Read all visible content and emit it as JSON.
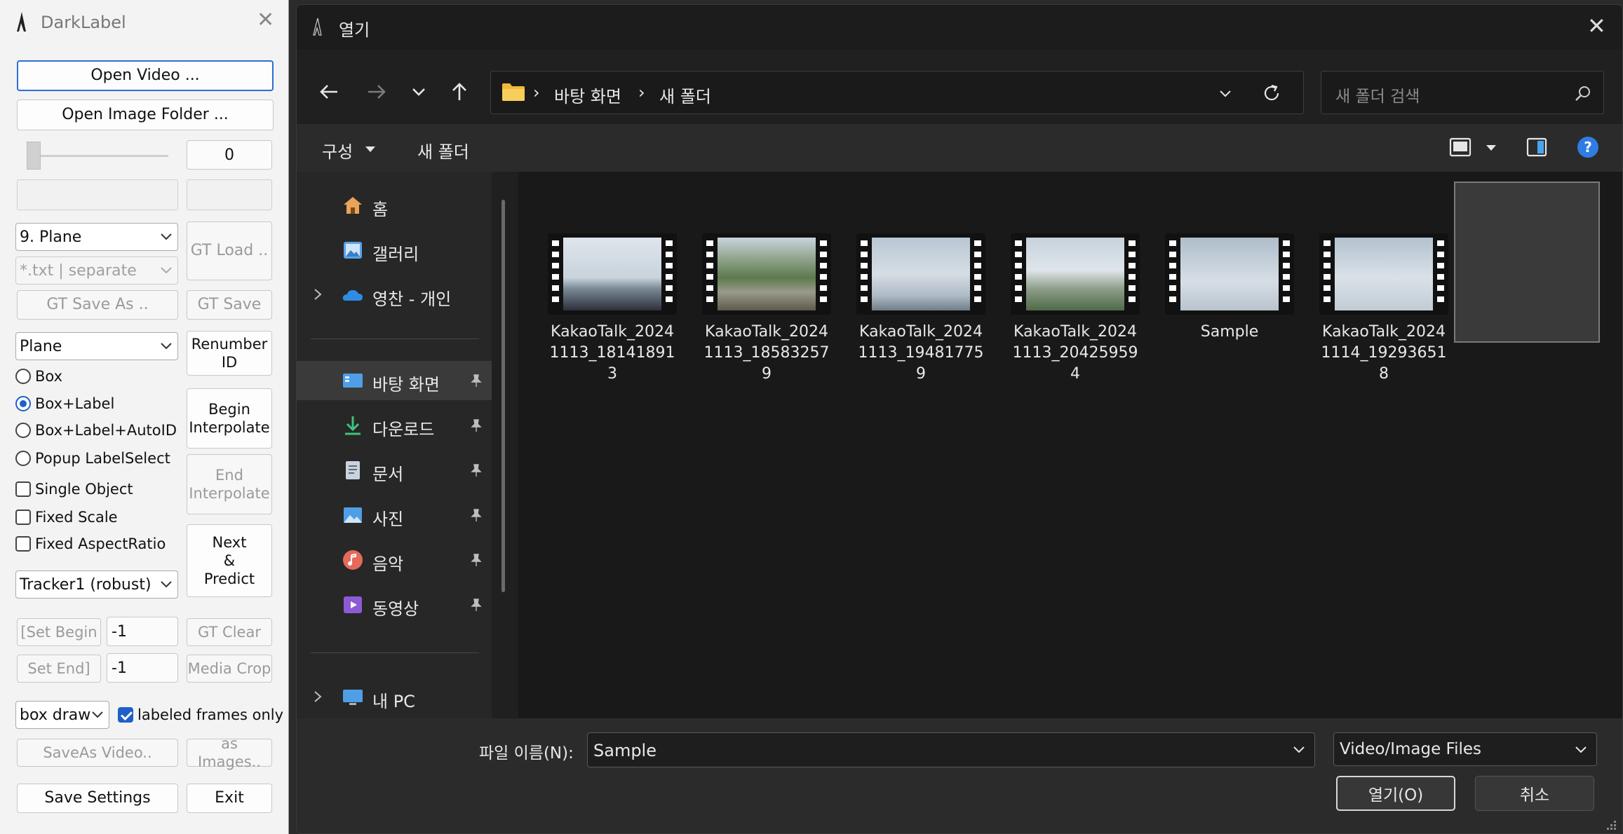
{
  "darklabel": {
    "title": "DarkLabel",
    "open_video": "Open Video ...",
    "open_image_folder": "Open Image Folder ...",
    "frame_number": "0",
    "class_select": "9. Plane",
    "format_select": "*.txt | separate",
    "gt_load": "GT Load ..",
    "gt_save_as": "GT Save As ..",
    "gt_save": "GT Save",
    "label_select": "Plane",
    "renumber_id": "Renumber ID",
    "radio_box": "Box",
    "radio_box_label": "Box+Label",
    "radio_box_label_autoid": "Box+Label+AutoID",
    "radio_popup": "Popup LabelSelect",
    "begin_interpolate": "Begin Interpolate",
    "end_interpolate": "End Interpolate",
    "single_object": "Single Object",
    "fixed_scale": "Fixed Scale",
    "fixed_aspect": "Fixed AspectRatio",
    "next_predict_1": "Next",
    "next_predict_2": "&",
    "next_predict_3": "Predict",
    "tracker_select": "Tracker1 (robust)",
    "set_begin": "[Set Begin",
    "set_begin_value": "-1",
    "gt_clear": "GT Clear",
    "set_end": "Set End]",
    "set_end_value": "-1",
    "media_crop": "Media Crop",
    "draw_select": "box draw",
    "labeled_frames_only": "labeled frames only",
    "save_as_video": "SaveAs Video..",
    "as_images": "as Images..",
    "save_settings": "Save Settings",
    "exit": "Exit"
  },
  "dialog": {
    "title": "열기",
    "path": [
      "바탕 화면",
      "새 폴더"
    ],
    "search_placeholder": "새 폴더 검색",
    "organize": "구성",
    "new_folder": "새 폴더",
    "nav": [
      {
        "label": "홈",
        "icon": "home-icon"
      },
      {
        "label": "갤러리",
        "icon": "gallery-icon"
      },
      {
        "label": "영찬 - 개인",
        "icon": "onedrive-icon"
      },
      {
        "label": "바탕 화면",
        "icon": "desktop-icon"
      },
      {
        "label": "다운로드",
        "icon": "download-icon"
      },
      {
        "label": "문서",
        "icon": "documents-icon"
      },
      {
        "label": "사진",
        "icon": "pictures-icon"
      },
      {
        "label": "음악",
        "icon": "music-icon"
      },
      {
        "label": "동영상",
        "icon": "videos-icon"
      },
      {
        "label": "내 PC",
        "icon": "this-pc-icon"
      }
    ],
    "files": [
      {
        "name": "KakaoTalk_20241113_181418913",
        "line1": "KakaoTalk_2024",
        "line2": "1113_18141891",
        "line3": "3"
      },
      {
        "name": "KakaoTalk_20241113_185832579",
        "line1": "KakaoTalk_2024",
        "line2": "1113_18583257",
        "line3": "9"
      },
      {
        "name": "KakaoTalk_20241113_194817759",
        "line1": "KakaoTalk_2024",
        "line2": "1113_19481775",
        "line3": "9"
      },
      {
        "name": "KakaoTalk_20241113_204259594",
        "line1": "KakaoTalk_2024",
        "line2": "1113_20425959",
        "line3": "4"
      },
      {
        "name": "Sample",
        "line1": "Sample",
        "line2": "",
        "line3": ""
      },
      {
        "name": "KakaoTalk_20241114_192936518",
        "line1": "KakaoTalk_2024",
        "line2": "1114_19293651",
        "line3": "8"
      }
    ],
    "filename_label": "파일 이름(N):",
    "filename_value": "Sample",
    "filetype_value": "Video/Image Files",
    "open_button": "열기(O)",
    "cancel_button": "취소"
  },
  "colors": {
    "accent": "#1e5fc9",
    "dialog_bg": "#202020",
    "content_bg": "#191919",
    "help_blue": "#2f7de1"
  }
}
